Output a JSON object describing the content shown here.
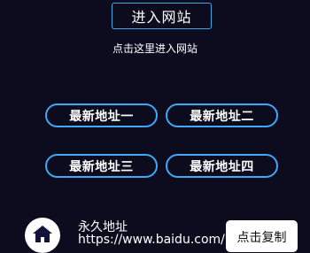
{
  "header": {
    "enter_label": "进入网站",
    "hint": "点击这里进入网站"
  },
  "addresses": [
    {
      "label": "最新地址一"
    },
    {
      "label": "最新地址二"
    },
    {
      "label": "最新地址三"
    },
    {
      "label": "最新地址四"
    }
  ],
  "footer": {
    "icon": "home-icon",
    "title": "永久地址",
    "url": "https://www.baidu.com/",
    "copy_label": "点击复制"
  },
  "colors": {
    "background": "#0c0c1e",
    "accent": "#3fa9f5",
    "text": "#ffffff"
  }
}
